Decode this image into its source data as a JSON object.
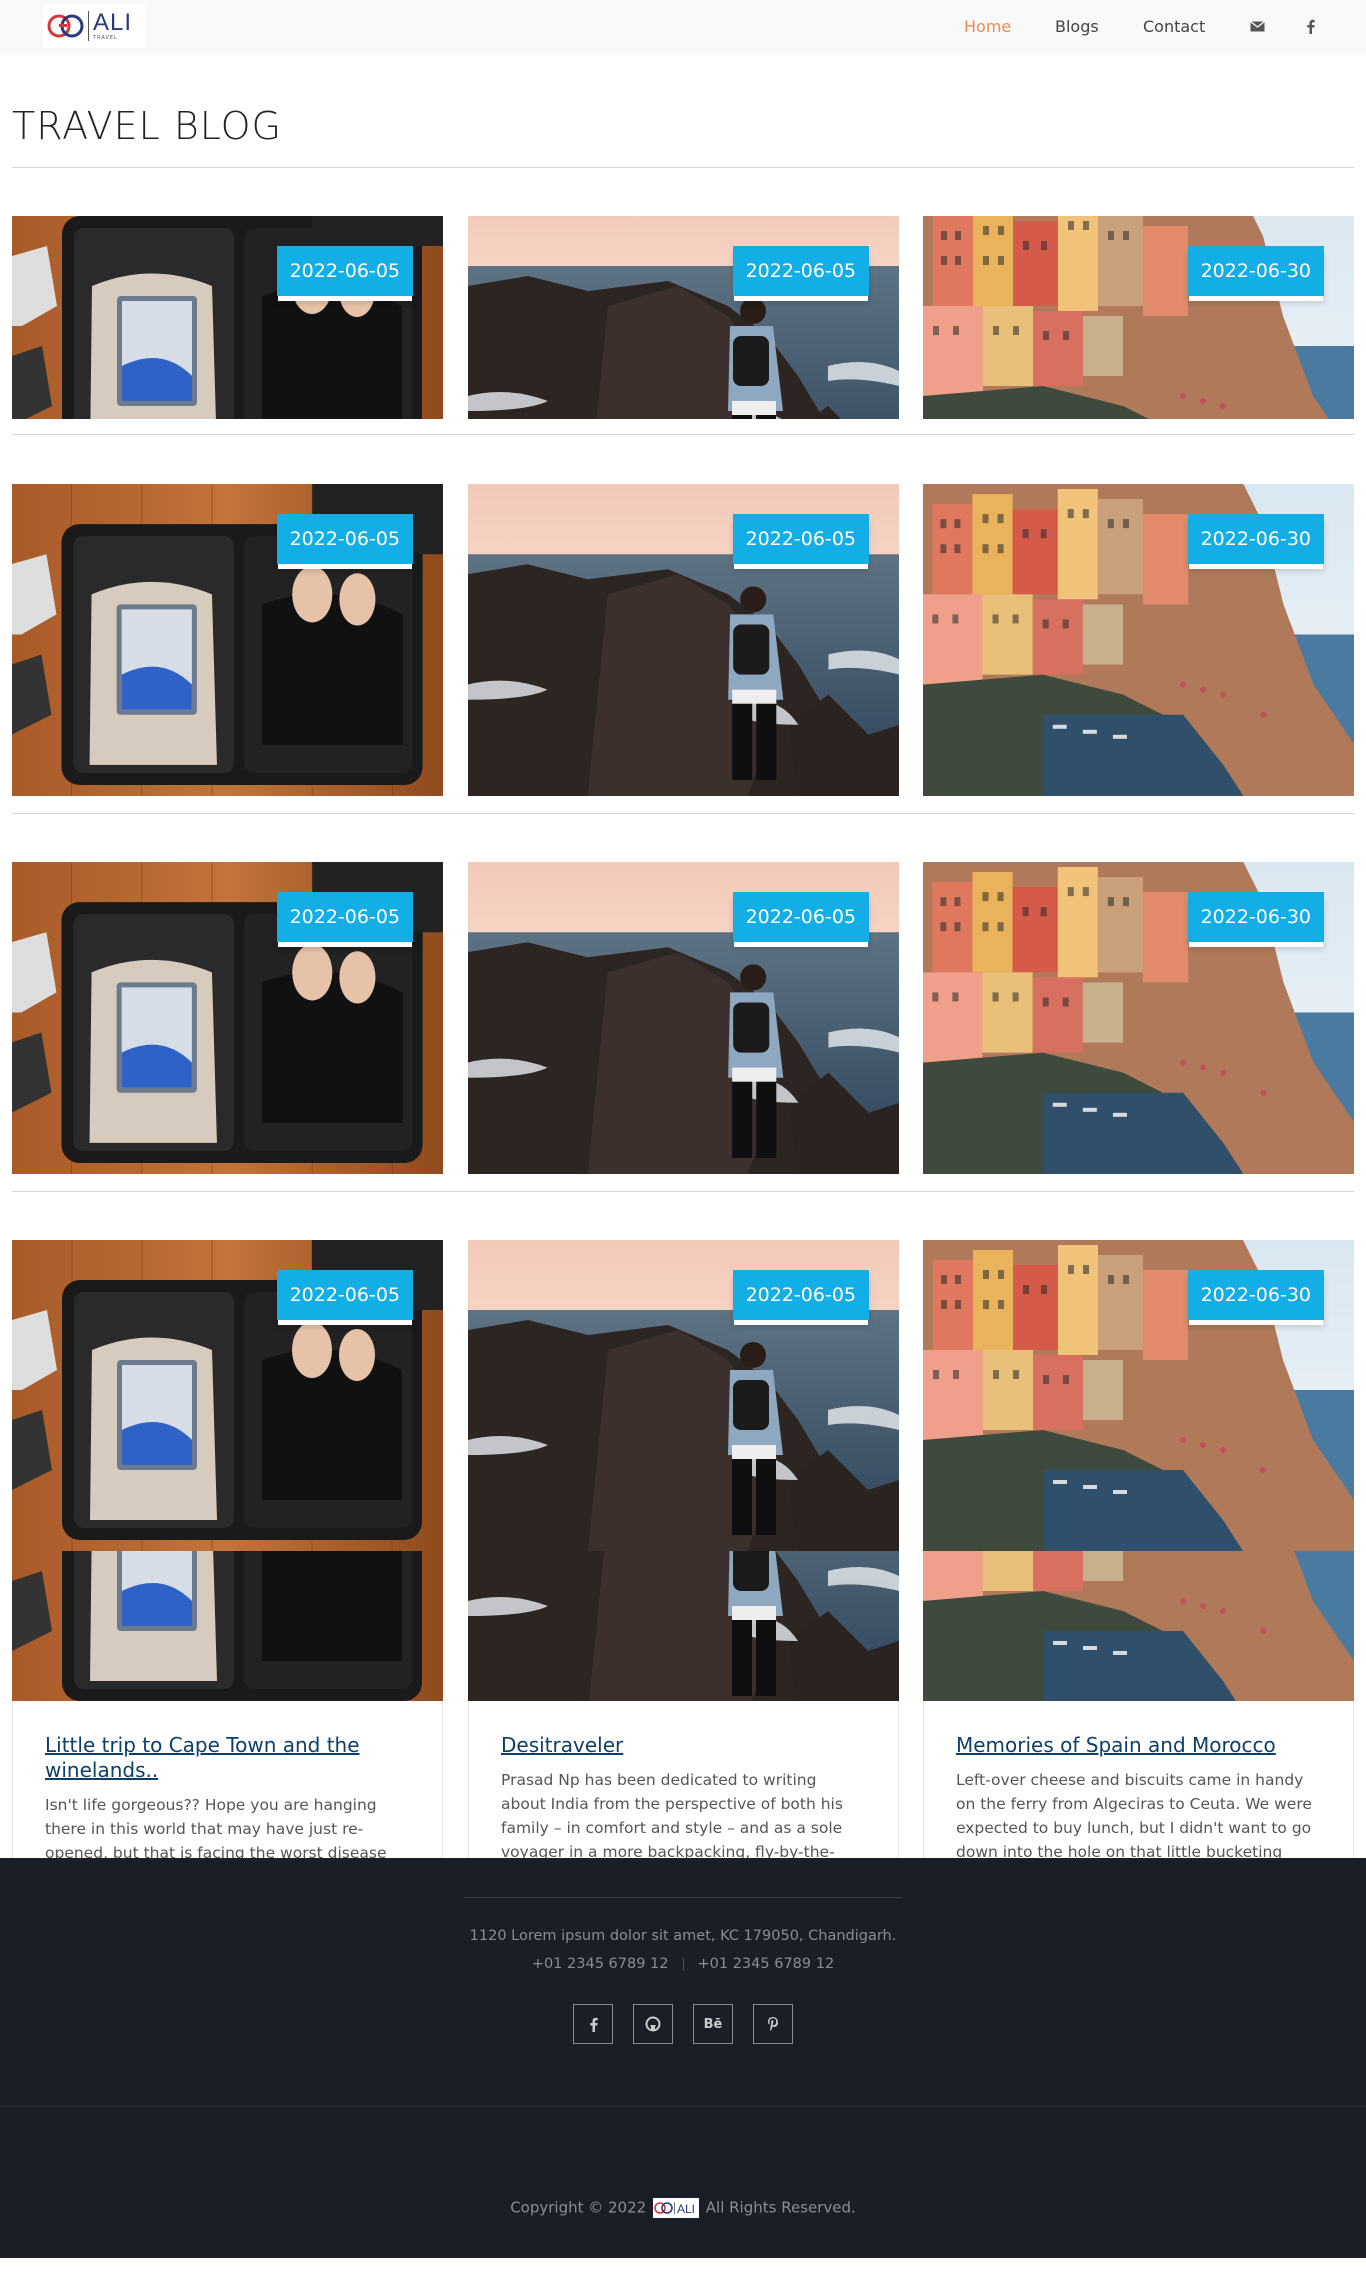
{
  "nav": {
    "logo_text": "ALI",
    "logo_sub": "TRAVEL",
    "links": [
      "Home",
      "Blogs",
      "Contact"
    ],
    "icons": [
      "envelope-icon",
      "facebook-icon"
    ],
    "active_color": "#f08a4b"
  },
  "page": {
    "title": "TRAVEL BLOG"
  },
  "rows": [
    {
      "dates": [
        "2022-06-05",
        "2022-06-05",
        "2022-06-30"
      ]
    },
    {
      "dates": [
        "2022-06-05",
        "2022-06-05",
        "2022-06-30"
      ]
    },
    {
      "dates": [
        "2022-06-05",
        "2022-06-05",
        "2022-06-30"
      ]
    }
  ],
  "posts": [
    {
      "date": "2022-06-05",
      "title": "Little trip to Cape Town and the winelands..",
      "excerpt": "Isn't life gorgeous?? Hope you are hanging there in this world that may have just re-opened, but that is facing the worst disease",
      "image": "suitcase"
    },
    {
      "date": "2022-06-05",
      "title": "Desitraveler",
      "excerpt": "Prasad Np has been dedicated to writing about India from the perspective of both his family – in comfort and style – and as a sole voyager in a more backpacking, fly-by-the-",
      "image": "cliff"
    },
    {
      "date": "2022-06-30",
      "title": "Memories of Spain and Morocco",
      "excerpt": "Left-over cheese and biscuits came in handy on the ferry from Algeciras to Ceuta. We were expected to buy lunch, but I didn't want to go down into the hole on that little bucketing",
      "image": "village"
    }
  ],
  "footer": {
    "address": "1120 Lorem ipsum dolor sit amet, KC 179050, Chandigarh.",
    "phone1": "+01 2345 6789 12",
    "phone2": "+01 2345 6789 12",
    "social_icons": [
      "facebook-icon",
      "github-icon",
      "behance-icon",
      "pinterest-icon"
    ],
    "social_glyphs": [
      "f",
      "◯",
      "Bē",
      "℗"
    ],
    "copyright_before": "Copyright © 2022",
    "copyright_after": "All Rights Reserved."
  },
  "colors": {
    "badge": "#14aee7",
    "footer_bg": "#1b1e26",
    "link": "#0d3f6b"
  }
}
